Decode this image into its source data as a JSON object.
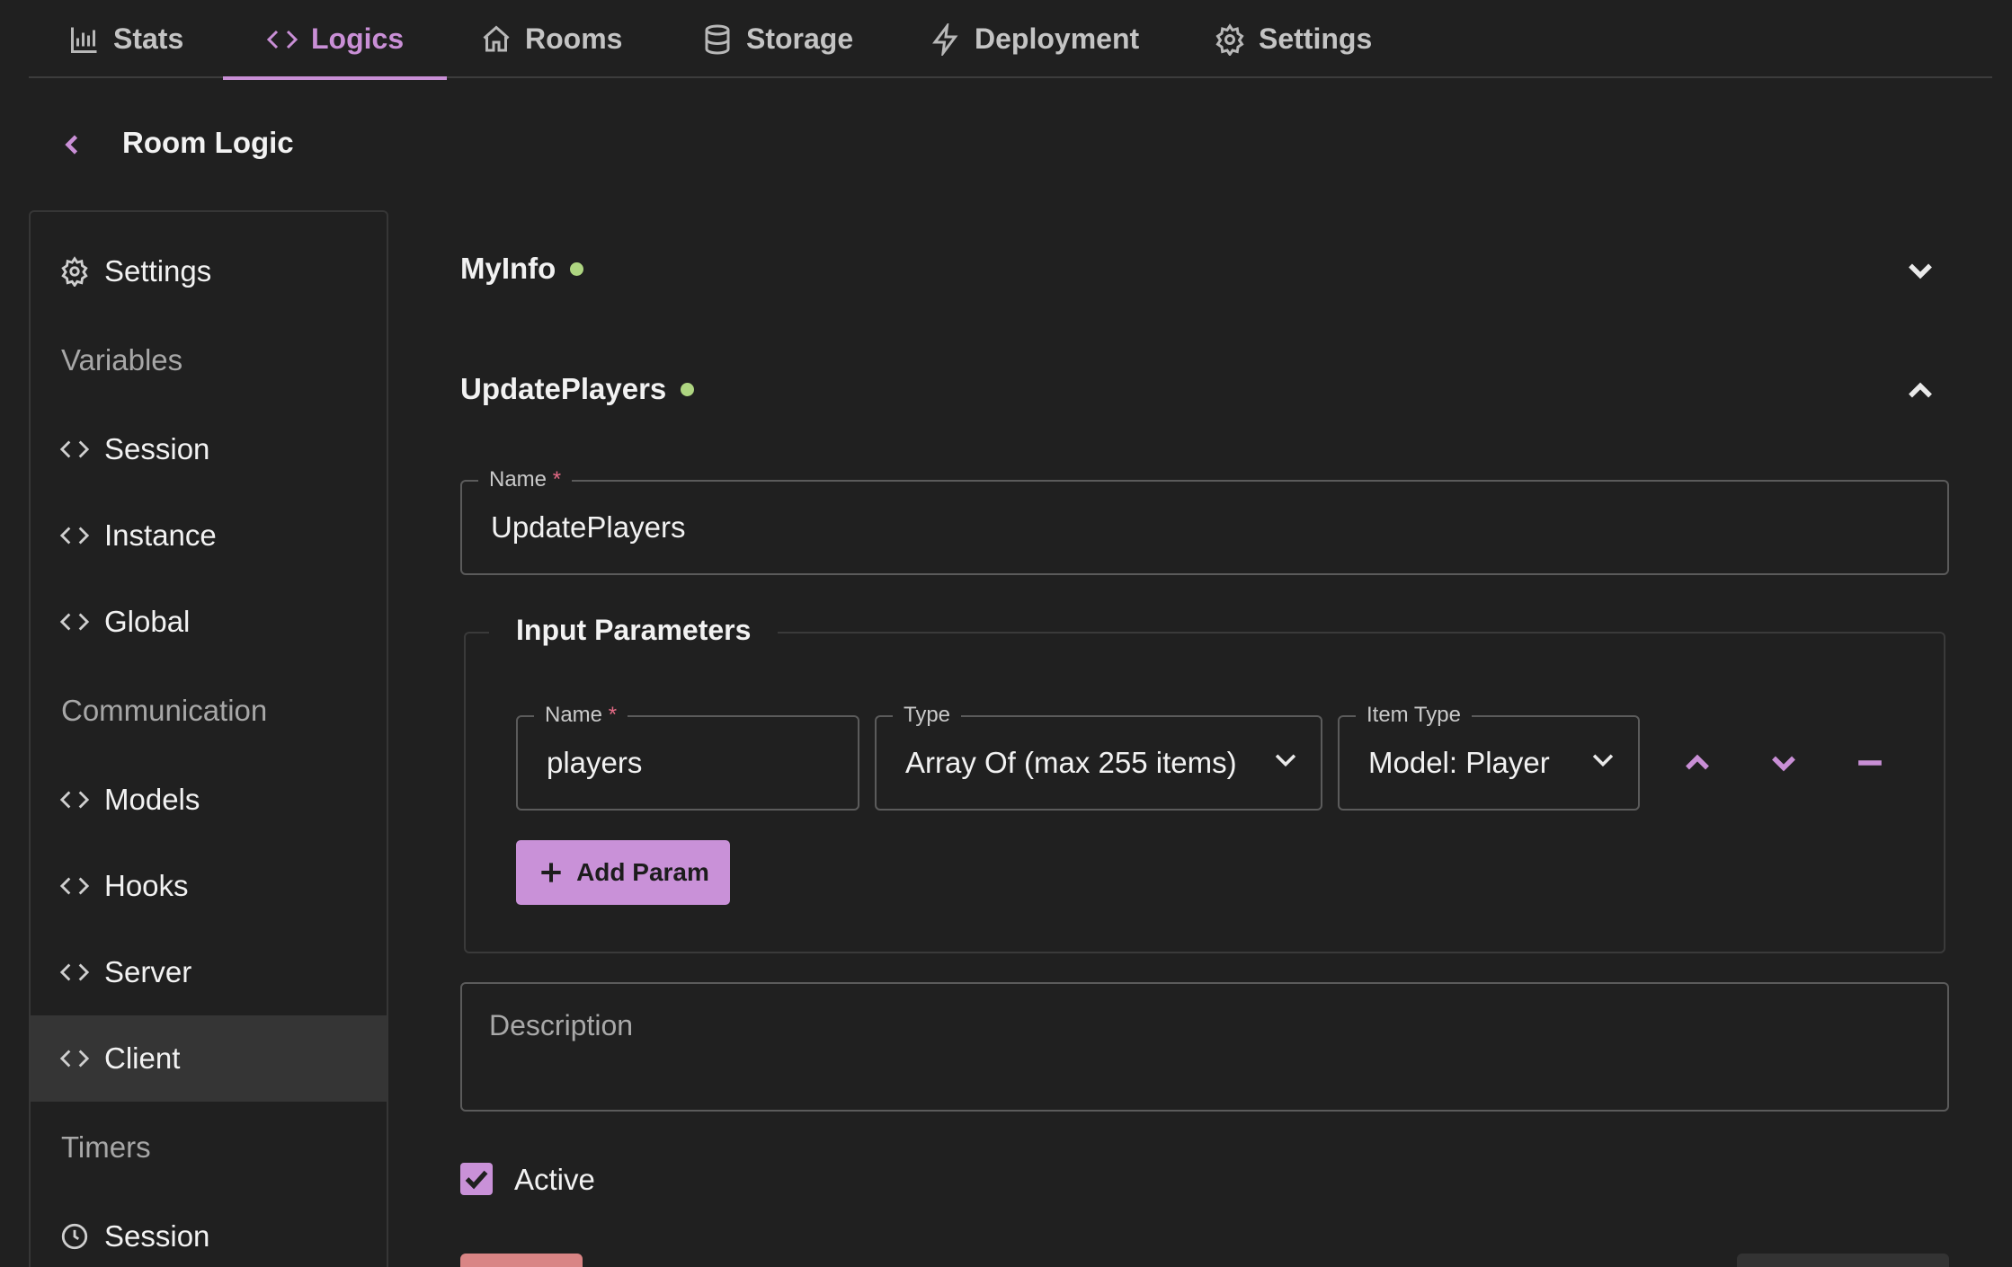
{
  "tabs": [
    {
      "label": "Stats",
      "icon": "bar-chart-icon"
    },
    {
      "label": "Logics",
      "icon": "code-icon",
      "active": true
    },
    {
      "label": "Rooms",
      "icon": "home-icon"
    },
    {
      "label": "Storage",
      "icon": "database-icon"
    },
    {
      "label": "Deployment",
      "icon": "bolt-icon"
    },
    {
      "label": "Settings",
      "icon": "gear-icon"
    }
  ],
  "header": {
    "title": "Room Logic"
  },
  "sidebar": {
    "settings_label": "Settings",
    "sections": {
      "variables": "Variables",
      "communication": "Communication",
      "timers": "Timers"
    },
    "variables": [
      "Session",
      "Instance",
      "Global"
    ],
    "communication": [
      "Models",
      "Hooks",
      "Server",
      "Client"
    ],
    "timers": [
      "Session"
    ],
    "selected": "Client"
  },
  "main": {
    "accordions": [
      {
        "title": "MyInfo",
        "status": "active",
        "expanded": false
      },
      {
        "title": "UpdatePlayers",
        "status": "active",
        "expanded": true
      }
    ],
    "name_field": {
      "label": "Name",
      "required": "*",
      "value": "UpdatePlayers"
    },
    "input_params": {
      "legend": "Input Parameters",
      "param": {
        "name_label": "Name",
        "required": "*",
        "name_value": "players",
        "type_label": "Type",
        "type_value": "Array Of (max 255 items)",
        "item_type_label": "Item Type",
        "item_type_value": "Model: Player"
      },
      "add_button": "Add Param"
    },
    "description": {
      "placeholder": "Description"
    },
    "active": {
      "label": "Active",
      "checked": true
    }
  },
  "colors": {
    "accent": "#c98fd6",
    "status_dot": "#aed581",
    "background": "#202020",
    "required": "#e46a85"
  }
}
